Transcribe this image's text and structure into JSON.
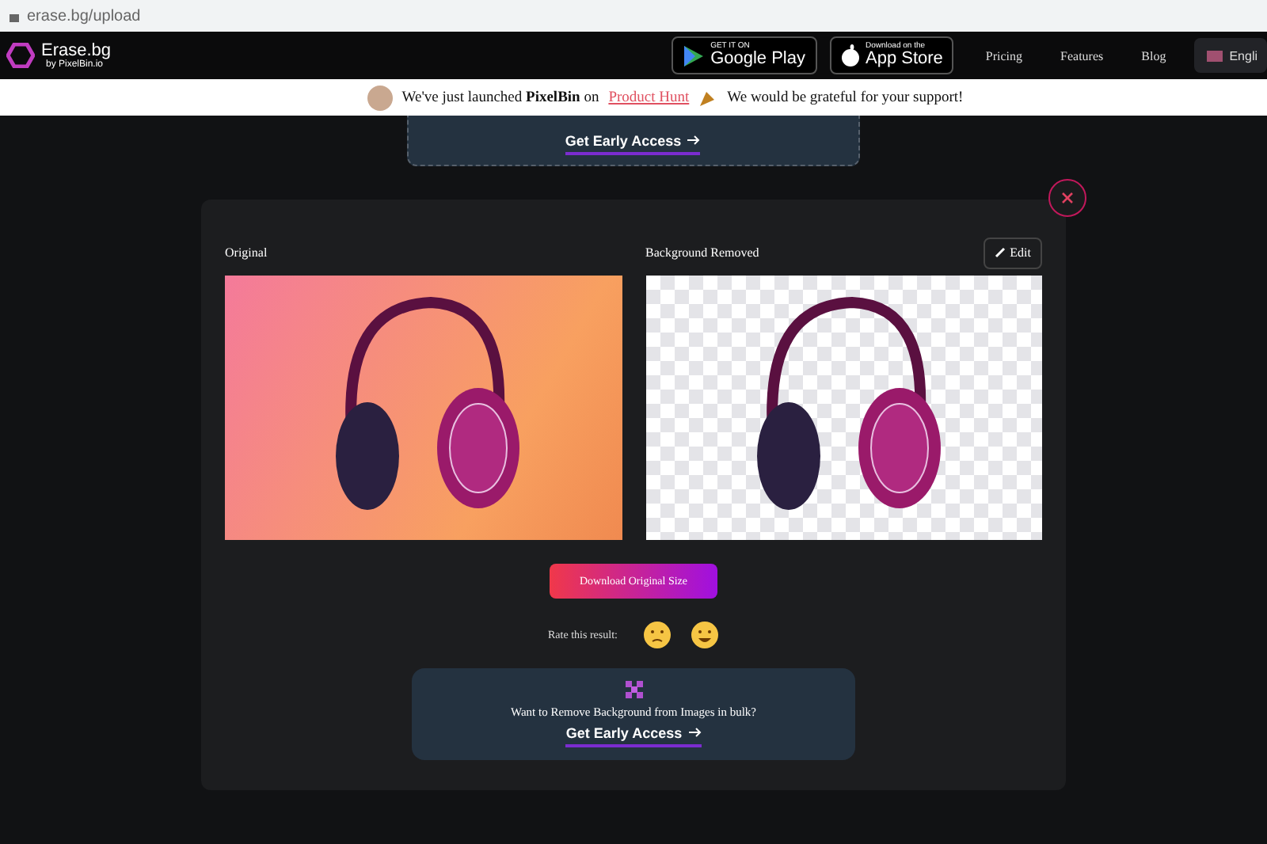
{
  "address_bar": {
    "url": "erase.bg/upload"
  },
  "nav": {
    "logo_title": "Erase.bg",
    "logo_subtitle": "by PixelBin.io",
    "store_buttons": [
      {
        "kind": "google",
        "small": "GET IT ON",
        "big": "Google Play"
      },
      {
        "kind": "apple",
        "small": "Download on the",
        "big": "App Store"
      }
    ],
    "links": [
      "Pricing",
      "Features",
      "Blog"
    ],
    "language": "Engli"
  },
  "banner": {
    "before": "We've just launched  **PixelBin** on",
    "link": "Product Hunt",
    "after": "We would be grateful for your support!"
  },
  "background_card": {
    "cta": "Get Early Access"
  },
  "modal": {
    "left_title": "Original",
    "right_title": "Background Removed",
    "edit_label": "Edit",
    "download_label": "Download Original Size",
    "rate_label": "Rate this result:",
    "ratings": [
      {
        "kind": "sad"
      },
      {
        "kind": "happy"
      }
    ],
    "bulk_card": {
      "text": "Want to Remove Background from Images in bulk?",
      "cta": "Get Early Access"
    }
  }
}
